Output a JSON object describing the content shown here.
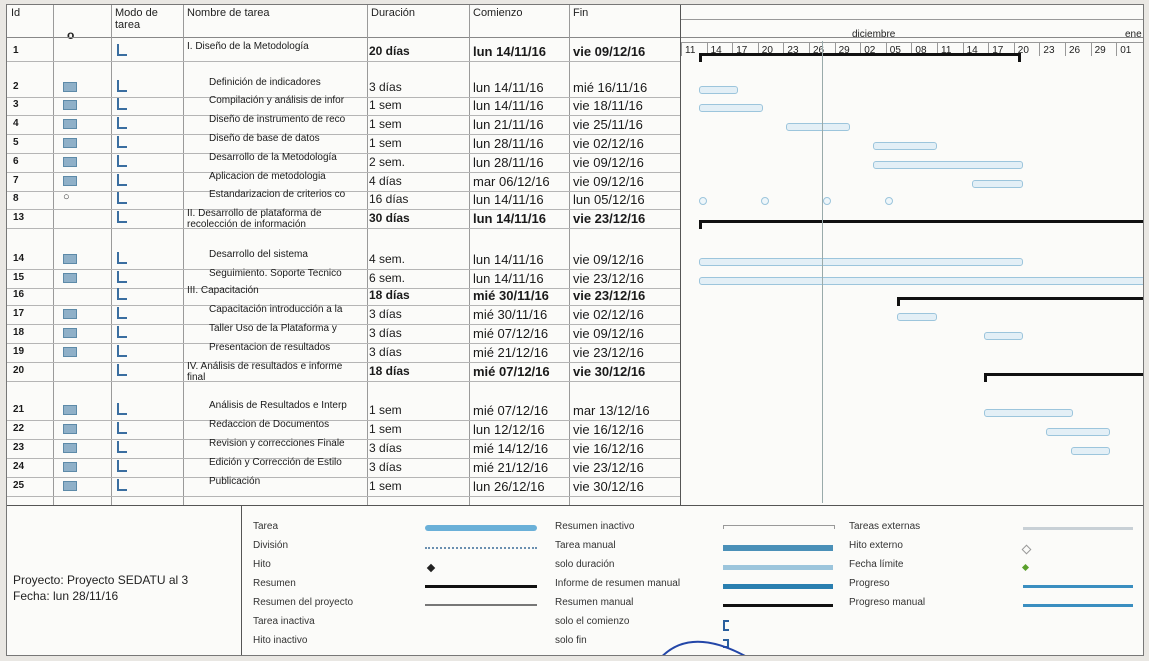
{
  "columns": {
    "id": "Id",
    "mode": "Modo de tarea",
    "name": "Nombre de tarea",
    "duration": "Duración",
    "start": "Comienzo",
    "end": "Fin"
  },
  "timescale": {
    "month1": "diciembre",
    "month2": "ene",
    "days": [
      "11",
      "14",
      "17",
      "20",
      "23",
      "26",
      "29",
      "02",
      "05",
      "08",
      "11",
      "14",
      "17",
      "20",
      "23",
      "26",
      "29",
      "01"
    ]
  },
  "rows": [
    {
      "id": "1",
      "name": "I. Diseño de la Metodología",
      "duration": "20 días",
      "start": "lun 14/11/16",
      "end": "vie 09/12/16",
      "summary": true
    },
    {
      "id": "2",
      "name": "Definición de indicadores",
      "duration": "3 días",
      "start": "lun 14/11/16",
      "end": "mié 16/11/16"
    },
    {
      "id": "3",
      "name": "Compilación y análisis de infor",
      "duration": "1 sem",
      "start": "lun 14/11/16",
      "end": "vie 18/11/16"
    },
    {
      "id": "4",
      "name": "Diseño de instrumento de reco",
      "duration": "1 sem",
      "start": "lun 21/11/16",
      "end": "vie 25/11/16"
    },
    {
      "id": "5",
      "name": "Diseño de base de datos",
      "duration": "1 sem",
      "start": "lun 28/11/16",
      "end": "vie 02/12/16"
    },
    {
      "id": "6",
      "name": "Desarrollo de la Metodología",
      "duration": "2 sem.",
      "start": "lun 28/11/16",
      "end": "vie 09/12/16"
    },
    {
      "id": "7",
      "name": "Aplicacion de metodologia",
      "duration": "4 días",
      "start": "mar 06/12/16",
      "end": "vie 09/12/16"
    },
    {
      "id": "8",
      "name": "Estandarizacion de criterios co",
      "duration": "16 días",
      "start": "lun 14/11/16",
      "end": "lun 05/12/16"
    },
    {
      "id": "13",
      "name": "II. Desarrollo de plataforma de recolección de información",
      "duration": "30 días",
      "start": "lun 14/11/16",
      "end": "vie 23/12/16",
      "summary": true
    },
    {
      "id": "14",
      "name": "Desarrollo del sistema",
      "duration": "4 sem.",
      "start": "lun 14/11/16",
      "end": "vie 09/12/16"
    },
    {
      "id": "15",
      "name": "Seguimiento. Soporte Tecnico",
      "duration": "6 sem.",
      "start": "lun 14/11/16",
      "end": "vie 23/12/16"
    },
    {
      "id": "16",
      "name": "III. Capacitación",
      "duration": "18 días",
      "start": "mié 30/11/16",
      "end": "vie 23/12/16",
      "summary": true
    },
    {
      "id": "17",
      "name": "Capacitación introducción a la",
      "duration": "3 días",
      "start": "mié 30/11/16",
      "end": "vie 02/12/16"
    },
    {
      "id": "18",
      "name": "Taller Uso de la Plataforma y",
      "duration": "3 días",
      "start": "mié 07/12/16",
      "end": "vie 09/12/16"
    },
    {
      "id": "19",
      "name": "Presentacion de resultados",
      "duration": "3 días",
      "start": "mié 21/12/16",
      "end": "vie 23/12/16"
    },
    {
      "id": "20",
      "name": "IV. Análisis de resultados e informe final",
      "duration": "18 días",
      "start": "mié 07/12/16",
      "end": "vie 30/12/16",
      "summary": true
    },
    {
      "id": "21",
      "name": "Análisis de Resultados e Interp",
      "duration": "1 sem",
      "start": "mié 07/12/16",
      "end": "mar 13/12/16"
    },
    {
      "id": "22",
      "name": "Redaccion de Documentos",
      "duration": "1 sem",
      "start": "lun 12/12/16",
      "end": "vie 16/12/16"
    },
    {
      "id": "23",
      "name": "Revision y correcciones Finale",
      "duration": "3 días",
      "start": "mié 14/12/16",
      "end": "vie 16/12/16"
    },
    {
      "id": "24",
      "name": "Edición y Corrección de Estilo",
      "duration": "3 días",
      "start": "mié 21/12/16",
      "end": "vie 23/12/16"
    },
    {
      "id": "25",
      "name": "Publicación",
      "duration": "1 sem",
      "start": "lun 26/12/16",
      "end": "vie 30/12/16"
    }
  ],
  "legend": {
    "project": "Proyecto: Proyecto SEDATU al 3",
    "date": "Fecha: lun 28/11/16",
    "col1": [
      "Tarea",
      "División",
      "Hito",
      "Resumen",
      "Resumen del proyecto",
      "Tarea inactiva",
      "Hito inactivo"
    ],
    "col2": [
      "Resumen inactivo",
      "Tarea manual",
      "solo duración",
      "Informe de resumen manual",
      "Resumen manual",
      "solo el comienzo",
      "solo fin"
    ],
    "col3": [
      "Tareas externas",
      "Hito externo",
      "Fecha límite",
      "Progreso",
      "Progreso manual"
    ]
  },
  "colors": {
    "task": "#6ab0d8",
    "summary": "#111111",
    "milestone_green": "#5aa02c"
  }
}
